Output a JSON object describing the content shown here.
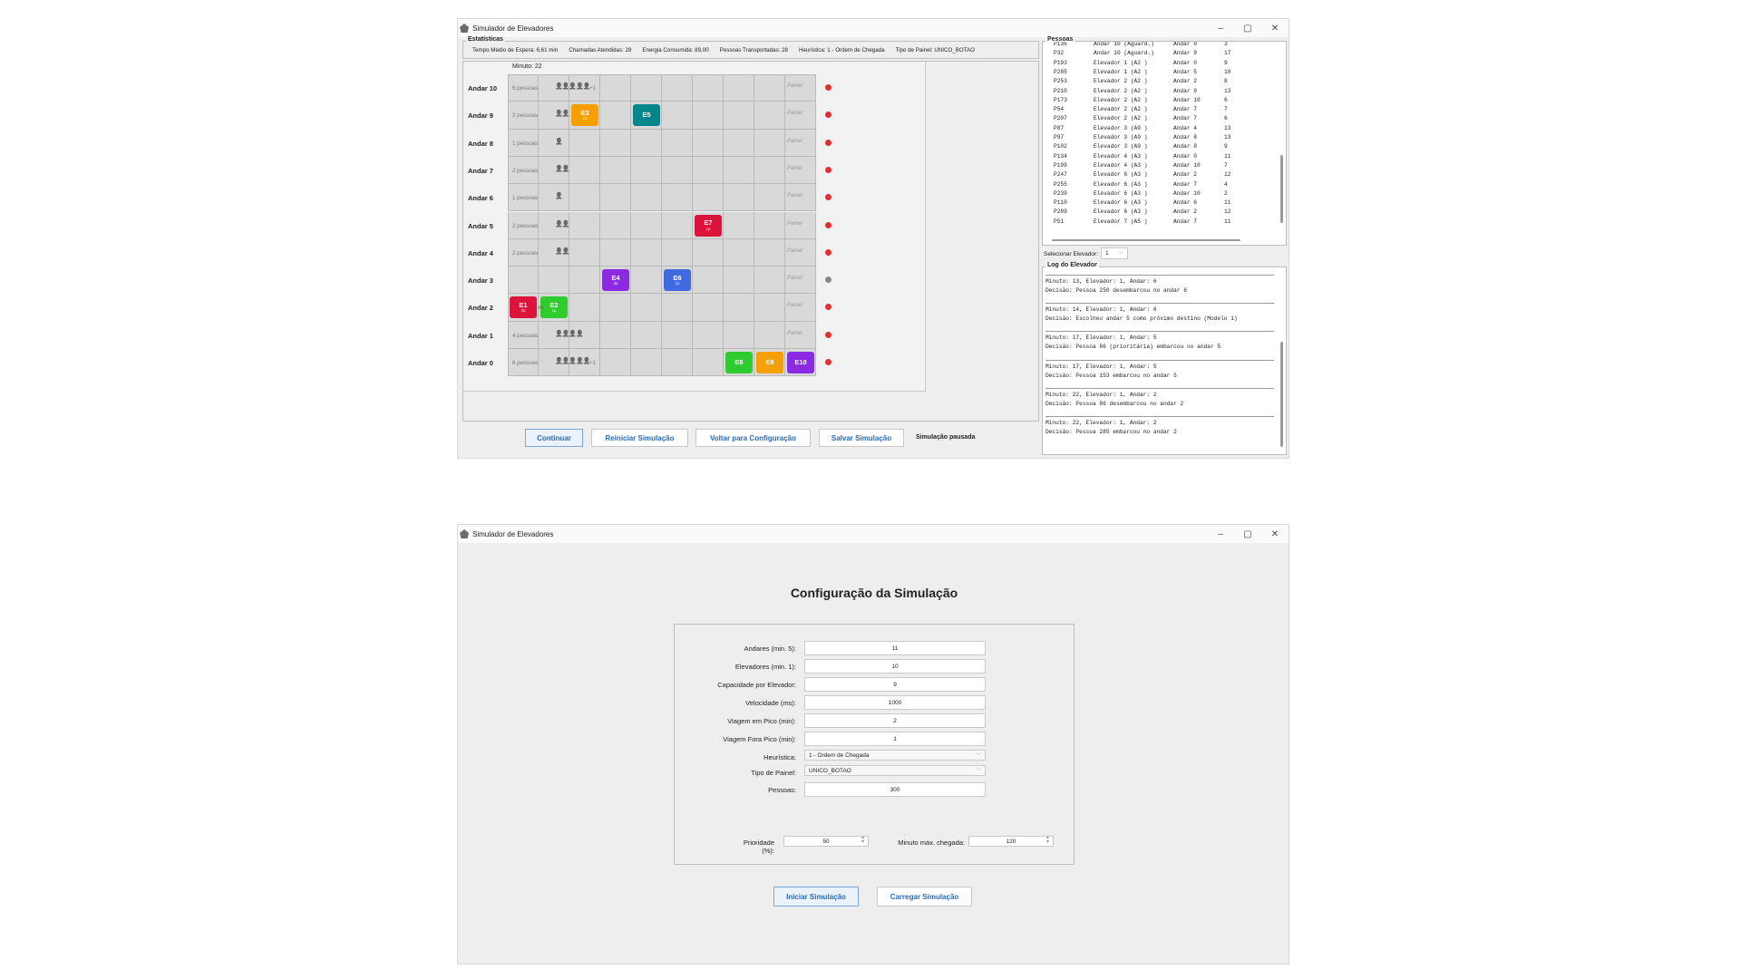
{
  "sim": {
    "title": "Simulador de Elevadores",
    "win_controls": [
      "–",
      "▢",
      "✕"
    ],
    "stats_title": "Estatísticas",
    "stats": [
      "Tempo Médio de Espera: 6,61 min",
      "Chamadas Atendidas: 28",
      "Energia Consumida: 89,00",
      "Pessoas Transportadas: 28",
      "Heurística: 1 - Ordem de Chegada",
      "Tipo de Painel: UNICO_BOTAO"
    ],
    "minute": "Minuto: 22",
    "floors": [
      {
        "label": "Andar 10",
        "count": "6 pessoas",
        "glyphs": "👤👤👤👤👤",
        "more": "+1",
        "painel": "Painel",
        "dot": "#e03030"
      },
      {
        "label": "Andar 9",
        "count": "2 pessoas",
        "glyphs": "👤👤",
        "more": "",
        "painel": "Painel",
        "dot": "#e03030"
      },
      {
        "label": "Andar 8",
        "count": "1 pessoas",
        "glyphs": "👤",
        "more": "",
        "painel": "Painel",
        "dot": "#e03030"
      },
      {
        "label": "Andar 7",
        "count": "2 pessoas",
        "glyphs": "👤👤",
        "more": "",
        "painel": "Painel",
        "dot": "#e03030"
      },
      {
        "label": "Andar 6",
        "count": "1 pessoas",
        "glyphs": "👤",
        "more": "",
        "painel": "Painel",
        "dot": "#e03030"
      },
      {
        "label": "Andar 5",
        "count": "2 pessoas",
        "glyphs": "👤👤",
        "more": "",
        "painel": "Painel",
        "dot": "#e03030"
      },
      {
        "label": "Andar 4",
        "count": "2 pessoas",
        "glyphs": "👤👤",
        "more": "",
        "painel": "Painel",
        "dot": "#e03030"
      },
      {
        "label": "Andar 3",
        "count": "",
        "glyphs": "",
        "more": "",
        "painel": "Painel",
        "dot": "#888888"
      },
      {
        "label": "Andar 2",
        "count": "",
        "glyphs": "",
        "more": "",
        "painel": "Painel",
        "dot": "#e03030"
      },
      {
        "label": "Andar 1",
        "count": "4 pessoas",
        "glyphs": "👤👤👤👤",
        "more": "",
        "painel": "Painel",
        "dot": "#e03030"
      },
      {
        "label": "Andar 0",
        "count": "6 pessoas",
        "glyphs": "👤👤👤👤👤",
        "more": "+1",
        "painel": "",
        "dot": "#e03030"
      }
    ],
    "elevators": [
      {
        "name": "E1",
        "sub": "2p",
        "color": "#dc143c",
        "floor": 2,
        "col": 0
      },
      {
        "name": "E2",
        "sub": "1p",
        "color": "#2ecc2e",
        "floor": 2,
        "col": 1
      },
      {
        "name": "E3",
        "sub": "1p",
        "color": "#f5a000",
        "floor": 9,
        "col": 2
      },
      {
        "name": "E4",
        "sub": "3p",
        "color": "#8a2be2",
        "floor": 3,
        "col": 3
      },
      {
        "name": "E5",
        "sub": "",
        "color": "#00868b",
        "floor": 9,
        "col": 4
      },
      {
        "name": "E6",
        "sub": "1p",
        "color": "#4169e1",
        "floor": 3,
        "col": 5
      },
      {
        "name": "E7",
        "sub": "1p",
        "color": "#dc143c",
        "floor": 5,
        "col": 6
      },
      {
        "name": "E8",
        "sub": "",
        "color": "#2ecc2e",
        "floor": 0,
        "col": 7
      },
      {
        "name": "E9",
        "sub": "",
        "color": "#f5a000",
        "floor": 0,
        "col": 8
      },
      {
        "name": "E10",
        "sub": "",
        "color": "#8a2be2",
        "floor": 0,
        "col": 9
      }
    ],
    "e1_tag": "es",
    "buttons": {
      "continue": "Continuar",
      "restart": "Reiniciar Simulação",
      "back": "Voltar para Configuração",
      "save": "Salvar Simulação"
    },
    "status": "Simulação pausada",
    "people_title": "Pessoas",
    "people": [
      [
        "P136",
        "Andar 10 (Aguard.)",
        "Andar 0",
        "3"
      ],
      [
        "P32",
        "Andar 10 (Aguard.)",
        "Andar 9",
        "17"
      ],
      [
        "P193",
        "Elevador 1 (A2 )",
        "Andar 0",
        "9"
      ],
      [
        "P285",
        "Elevador 1 (A2 )",
        "Andar 5",
        "10"
      ],
      [
        "P253",
        "Elevador 2 (A2 )",
        "Andar 2",
        "8"
      ],
      [
        "P210",
        "Elevador 2 (A2 )",
        "Andar 9",
        "13"
      ],
      [
        "P173",
        "Elevador 2 (A2 )",
        "Andar 10",
        "6"
      ],
      [
        "P54",
        "Elevador 2 (A2 )",
        "Andar 7",
        "7"
      ],
      [
        "P207",
        "Elevador 2 (A2 )",
        "Andar 7",
        "6"
      ],
      [
        "P87",
        "Elevador 3 (A9 )",
        "Andar 4",
        "13"
      ],
      [
        "P97",
        "Elevador 3 (A9 )",
        "Andar 8",
        "13"
      ],
      [
        "P102",
        "Elevador 3 (A9 )",
        "Andar 8",
        "9"
      ],
      [
        "P134",
        "Elevador 4 (A3 )",
        "Andar 0",
        "11"
      ],
      [
        "P199",
        "Elevador 4 (A3 )",
        "Andar 10",
        "7"
      ],
      [
        "P247",
        "Elevador 6 (A3 )",
        "Andar 2",
        "12"
      ],
      [
        "P255",
        "Elevador 6 (A3 )",
        "Andar 7",
        "4"
      ],
      [
        "P239",
        "Elevador 6 (A3 )",
        "Andar 10",
        "2"
      ],
      [
        "P110",
        "Elevador 6 (A3 )",
        "Andar 6",
        "11"
      ],
      [
        "P289",
        "Elevador 6 (A3 )",
        "Andar 2",
        "12"
      ],
      [
        "P51",
        "Elevador 7 (A5 )",
        "Andar 7",
        "11"
      ]
    ],
    "select_label": "Selecionar Elevador:",
    "select_value": "1",
    "log_title": "Log do Elevador",
    "log": [
      [
        "Minuto: 13, Elevador: 1, Andar: 6",
        "Decisão: Pessoa 250 desembarcou no andar 6"
      ],
      [
        "Minuto: 14, Elevador: 1, Andar: 6",
        "Decisão: Escolheu andar 5 como próximo destino (Modelo 1)"
      ],
      [
        "Minuto: 17, Elevador: 1, Andar: 5",
        "Decisão: Pessoa 86 (prioritária) embarcou no andar 5"
      ],
      [
        "Minuto: 17, Elevador: 1, Andar: 5",
        "Decisão: Pessoa 153 embarcou no andar 5"
      ],
      [
        "Minuto: 22, Elevador: 1, Andar: 2",
        "Decisão: Pessoa 86 desembarcou no andar 2"
      ],
      [
        "Minuto: 22, Elevador: 1, Andar: 2",
        "Decisão: Pessoa 285 embarcou no andar 2"
      ]
    ]
  },
  "config": {
    "title": "Simulador de Elevadores",
    "heading": "Configuração da Simulação",
    "fields": [
      {
        "label": "Andares (min. 5):",
        "value": "11"
      },
      {
        "label": "Elevadores (min. 1):",
        "value": "10"
      },
      {
        "label": "Capacidade por Elevador:",
        "value": "9"
      },
      {
        "label": "Velocidade (ms):",
        "value": "1000"
      },
      {
        "label": "Viagem em Pico (min):",
        "value": "2"
      },
      {
        "label": "Viagem Fora Pico (min):",
        "value": "1"
      },
      {
        "label": "Heurística:",
        "value": "1 - Ordem de Chegada"
      },
      {
        "label": "Tipo de Painel:",
        "value": "UNICO_BOTAO"
      },
      {
        "label": "Pessoas:",
        "value": "300"
      }
    ],
    "priority_label": "Prioridade (%):",
    "priority_value": "50",
    "max_arrival_label": "Minuto máx. chegada:",
    "max_arrival_value": "120",
    "start_button": "Iniciar Simulação",
    "load_button": "Carregar Simulação"
  }
}
